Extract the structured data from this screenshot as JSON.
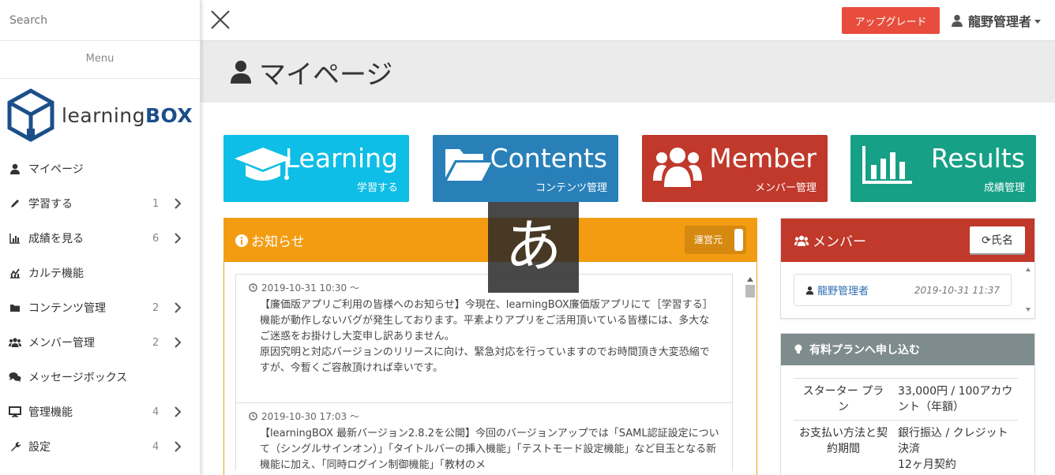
{
  "sidebar": {
    "search_placeholder": "Search",
    "menu_label": "Menu",
    "logo_prefix": "learning",
    "logo_suffix": "BOX",
    "items": [
      {
        "label": "マイページ",
        "icon": "user-icon",
        "count": ""
      },
      {
        "label": "学習する",
        "icon": "pencil-icon",
        "count": "1"
      },
      {
        "label": "成績を見る",
        "icon": "bar-chart-icon",
        "count": "6"
      },
      {
        "label": "カルテ機能",
        "icon": "line-chart-icon",
        "count": ""
      },
      {
        "label": "コンテンツ管理",
        "icon": "folder-icon",
        "count": "2"
      },
      {
        "label": "メンバー管理",
        "icon": "users-icon",
        "count": "2"
      },
      {
        "label": "メッセージボックス",
        "icon": "comments-icon",
        "count": ""
      },
      {
        "label": "管理機能",
        "icon": "monitor-icon",
        "count": "4"
      },
      {
        "label": "設定",
        "icon": "wrench-icon",
        "count": "4"
      }
    ]
  },
  "topbar": {
    "upgrade_label": "アップグレード",
    "user_name": "龍野管理者"
  },
  "page": {
    "title": "マイページ"
  },
  "tiles": [
    {
      "title": "Learning",
      "subtitle": "学習する",
      "color": "#0ebee6",
      "icon": "graduation-cap-icon"
    },
    {
      "title": "Contents",
      "subtitle": "コンテンツ管理",
      "color": "#2980b9",
      "icon": "folder-open-icon"
    },
    {
      "title": "Member",
      "subtitle": "メンバー管理",
      "color": "#c0392b",
      "icon": "users-icon"
    },
    {
      "title": "Results",
      "subtitle": "成績管理",
      "color": "#16a085",
      "icon": "bar-chart-icon"
    }
  ],
  "news": {
    "title": "お知らせ",
    "toggle_label": "運営元",
    "items": [
      {
        "time": "2019-10-31 10:30 ～",
        "body": "【廉価版アプリご利用の皆様へのお知らせ】今現在、learningBOX廉価版アプリにて［学習する］機能が動作しないバグが発生しております。平素よりアプリをご活用頂いている皆様には、多大なご迷惑をお掛けし大変申し訳ありません。\n原因究明と対応バージョンのリリースに向け、緊急対応を行っていますのでお時間頂き大変恐縮ですが、今暫くご容赦頂ければ幸いです。"
      },
      {
        "time": "2019-10-30 17:03 ～",
        "body": "【learningBOX 最新バージョン2.8.2を公開】今回のバージョンアップでは「SAML認証設定について（シングルサインオン）」「タイトルバーの挿入機能」「テストモード設定機能」など目玉となる新機能に加え、「同時ログイン制御機能」「教材のメ"
      }
    ]
  },
  "ime_char": "あ",
  "member": {
    "title": "メンバー",
    "sort_label": "氏名",
    "rows": [
      {
        "name": "龍野管理者",
        "date": "2019-10-31 11:37"
      }
    ]
  },
  "plan": {
    "title": "有料プランへ申し込む",
    "rows": [
      {
        "key": "スターター プラン",
        "value": "33,000円 / 100アカウント（年額）"
      },
      {
        "key": "お支払い方法と契約期間",
        "value": "銀行振込 / クレジット決済\n12ヶ月契約"
      }
    ]
  }
}
